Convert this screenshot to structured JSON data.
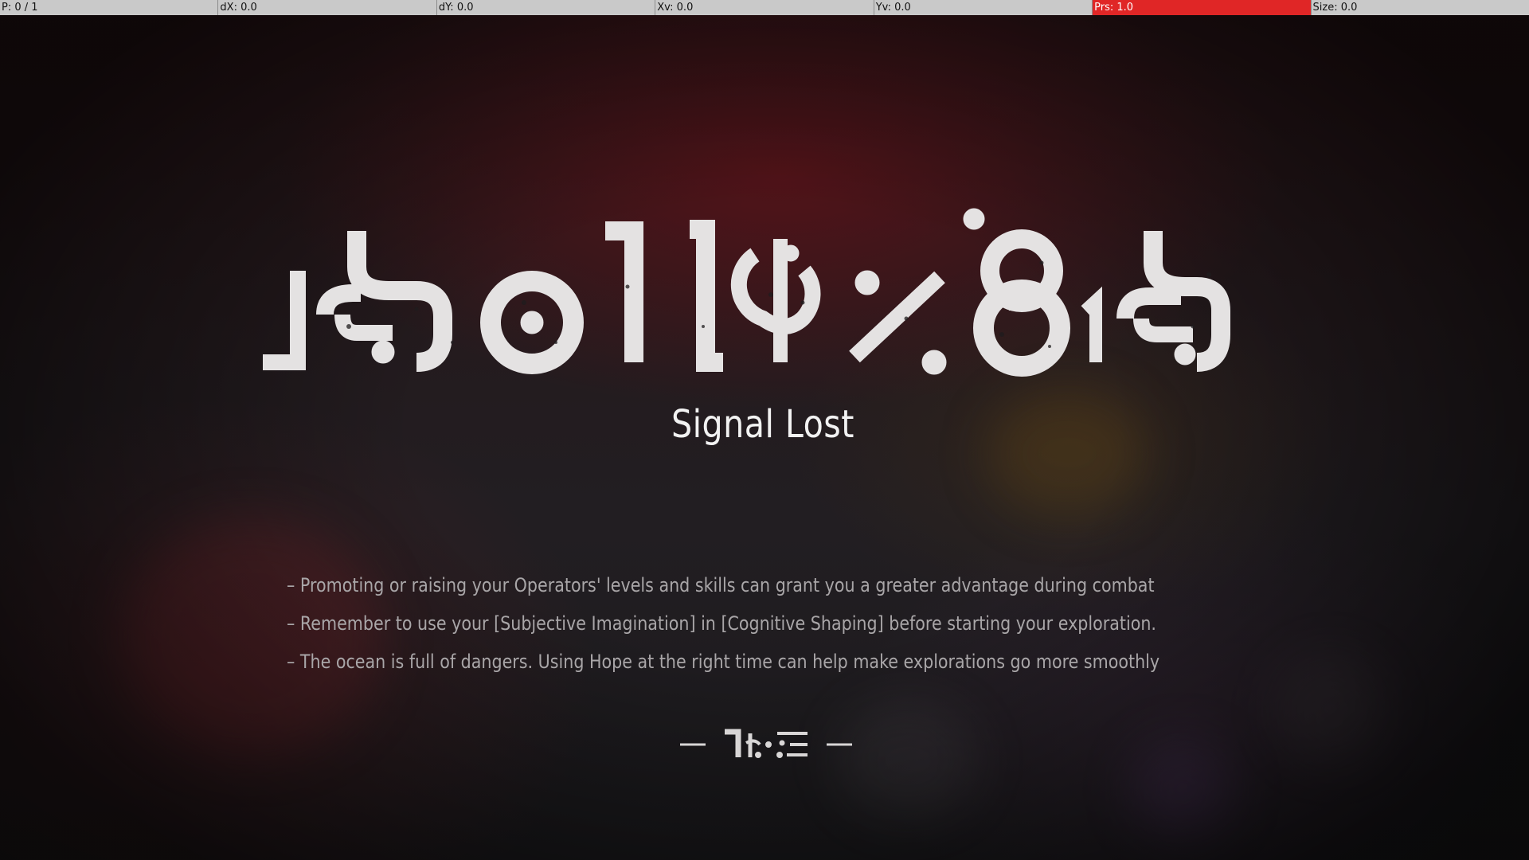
{
  "debug_bar": {
    "cells": [
      {
        "text": "P: 0 / 1"
      },
      {
        "text": "dX: 0.0"
      },
      {
        "text": "dY: 0.0"
      },
      {
        "text": "Xv: 0.0"
      },
      {
        "text": "Yv: 0.0"
      },
      {
        "text": "Prs: 1.0"
      },
      {
        "text": "Size: 0.0"
      }
    ],
    "alert_color": "#e02626"
  },
  "screen": {
    "logo_icon": "stylized-glyph-logo",
    "subtitle": "Signal Lost",
    "tips": [
      "– Promoting or raising your Operators' levels and skills can grant you a greater advantage during combat",
      "– Remember to use your [Subjective Imagination] in [Cognitive Shaping] before starting your exploration.",
      "– The ocean is full of dangers. Using Hope at the right time can help make explorations go more smoothly"
    ],
    "loading_icon": "glyph-loading-indicator"
  },
  "colors": {
    "background": "#1e1a1d",
    "accent_red": "#5a1218",
    "text_primary": "#f2f2f2",
    "text_secondary": "#a9a6a8"
  }
}
